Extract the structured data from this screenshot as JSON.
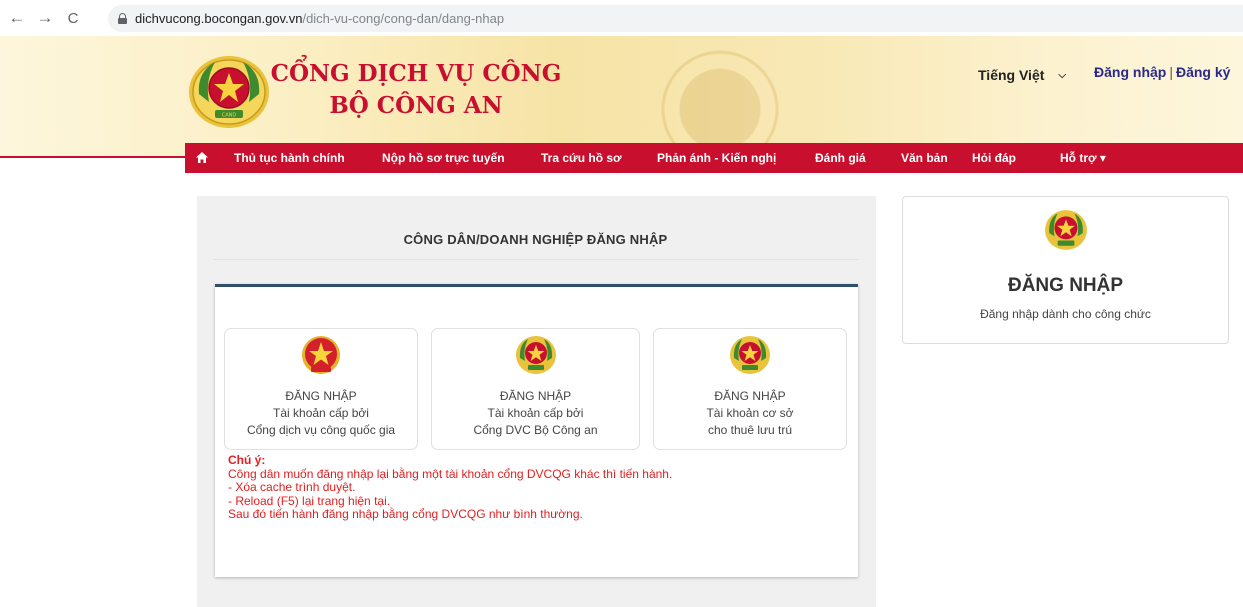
{
  "browser": {
    "back_icon": "←",
    "forward_icon": "→",
    "reload_icon": "C",
    "url_domain": "dichvucong.bocongan.gov.vn",
    "url_path": "/dich-vu-cong/cong-dan/dang-nhap"
  },
  "header": {
    "title_line1": "CỔNG DỊCH VỤ CÔNG",
    "title_line2": "BỘ CÔNG AN",
    "language": "Tiếng Việt",
    "login_link": "Đăng nhập",
    "separator": "|",
    "register_link": "Đăng ký"
  },
  "nav": {
    "items": [
      {
        "label": "Thủ tục hành chính"
      },
      {
        "label": "Nộp hồ sơ trực tuyến"
      },
      {
        "label": "Tra cứu hồ sơ"
      },
      {
        "label": "Phản ánh - Kiến nghị"
      },
      {
        "label": "Đánh giá"
      },
      {
        "label": "Văn bản"
      },
      {
        "label": "Hỏi đáp"
      },
      {
        "label": "Hỗ trợ ▾"
      }
    ]
  },
  "main": {
    "title": "CÔNG DÂN/DOANH NGHIỆP ĐĂNG NHẬP",
    "cards": [
      {
        "line1": "ĐĂNG NHẬP",
        "line2": "Tài khoản cấp bởi",
        "line3": "Cổng dịch vụ công quốc gia",
        "logo": "national-emblem-icon"
      },
      {
        "line1": "ĐĂNG NHẬP",
        "line2": "Tài khoản cấp bởi",
        "line3": "Cổng DVC Bộ Công an",
        "logo": "police-badge-icon"
      },
      {
        "line1": "ĐĂNG NHẬP",
        "line2": "Tài khoản cơ sở",
        "line3": "cho thuê lưu trú",
        "logo": "police-badge-icon"
      }
    ],
    "notice": {
      "heading": "Chú ý:",
      "lines": [
        "Công dân muốn đăng nhập lại bằng một tài khoản cổng DVCQG khác thì tiến hành.",
        "- Xóa cache trình duyệt.",
        "- Reload (F5) lại trang hiện tại.",
        "Sau đó tiến hành đăng nhập bằng cổng DVCQG như bình thường."
      ]
    }
  },
  "side": {
    "title": "ĐĂNG NHẬP",
    "subtitle": "Đăng nhập dành cho công chức"
  },
  "colors": {
    "brand_red": "#c8102e",
    "notice_red": "#e02020",
    "header_bg": "#f8e8b4"
  }
}
